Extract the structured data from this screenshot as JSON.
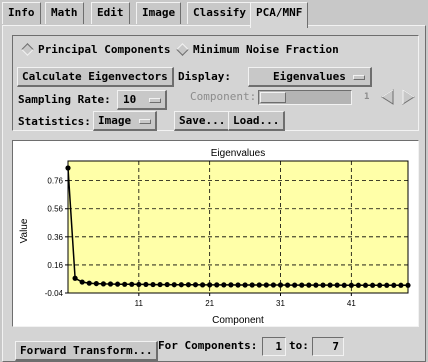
{
  "tabs": [
    "Info",
    "Math",
    "Edit",
    "Image",
    "Classify",
    "PCA/MNF"
  ],
  "active_tab": "PCA/MNF",
  "mode": {
    "principal_components_label": "Principal Components",
    "minimum_noise_fraction_label": "Minimum Noise Fraction",
    "selected": "Principal Components"
  },
  "controls": {
    "calculate_label": "Calculate Eigenvectors",
    "display_label": "Display:",
    "display_value": "Eigenvalues",
    "sampling_rate_label": "Sampling Rate:",
    "sampling_rate_value": "10",
    "component_label": "Component:",
    "component_value": "1",
    "statistics_label": "Statistics:",
    "statistics_value": "Image",
    "save_label": "Save...",
    "load_label": "Load..."
  },
  "bottom": {
    "forward_transform_label": "Forward Transform...",
    "for_components_label": "For Components:",
    "from_value": "1",
    "to_label": "to:",
    "to_value": "7"
  },
  "colors": {
    "plot_background": "#ffffa8",
    "window_background": "#c8c8c8"
  },
  "chart_data": {
    "type": "line",
    "title": "Eigenvalues",
    "xlabel": "Component",
    "ylabel": "Value",
    "x_ticks": [
      11,
      21,
      31,
      41
    ],
    "y_ticks": [
      -0.04,
      0.16,
      0.36,
      0.56,
      0.76
    ],
    "y_tick_labels": [
      "-0.04",
      "0.16",
      "0.36",
      "0.56",
      "0.76"
    ],
    "xlim": [
      1,
      49
    ],
    "ylim": [
      -0.04,
      0.9
    ],
    "grid": true,
    "series": [
      {
        "x": [
          1,
          2,
          3,
          4,
          5,
          6,
          7,
          8,
          9,
          10,
          11,
          12,
          13,
          14,
          15,
          16,
          17,
          18,
          19,
          20,
          21,
          22,
          23,
          24,
          25,
          26,
          27,
          28,
          29,
          30,
          31,
          32,
          33,
          34,
          35,
          36,
          37,
          38,
          39,
          40,
          41,
          42,
          43,
          44,
          45,
          46,
          47,
          48,
          49
        ],
        "values": [
          0.85,
          0.065,
          0.038,
          0.03,
          0.027,
          0.025,
          0.024,
          0.023,
          0.022,
          0.022,
          0.021,
          0.021,
          0.02,
          0.02,
          0.02,
          0.019,
          0.019,
          0.019,
          0.019,
          0.018,
          0.018,
          0.018,
          0.018,
          0.018,
          0.017,
          0.017,
          0.017,
          0.017,
          0.017,
          0.017,
          0.017,
          0.016,
          0.016,
          0.016,
          0.016,
          0.016,
          0.016,
          0.016,
          0.016,
          0.015,
          0.015,
          0.015,
          0.015,
          0.015,
          0.015,
          0.015,
          0.015,
          0.015,
          0.015
        ]
      }
    ]
  }
}
